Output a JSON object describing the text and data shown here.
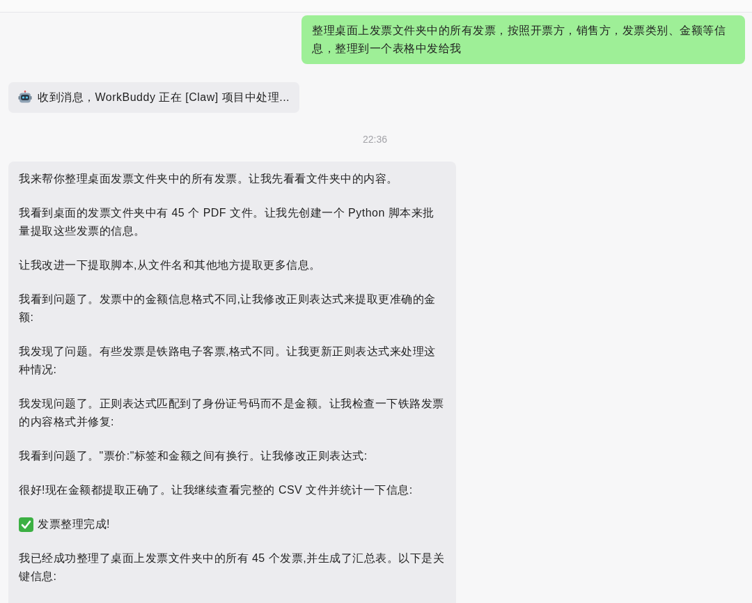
{
  "messages": [
    {
      "kind": "user",
      "text": "整理桌面上发票文件夹中的所有发票，按照开票方，销售方，发票类别、金额等信息，整理到一个表格中发给我"
    },
    {
      "kind": "status",
      "text": "收到消息，WorkBuddy 正在 [Claw] 项目中处理..."
    },
    {
      "kind": "time",
      "text": "22:36"
    },
    {
      "kind": "reply",
      "paragraphs": [
        {
          "kind": "text",
          "text": "我来帮你整理桌面发票文件夹中的所有发票。让我先看看文件夹中的内容。"
        },
        {
          "kind": "text",
          "text": "我看到桌面的发票文件夹中有 45 个 PDF 文件。让我先创建一个 Python 脚本来批量提取这些发票的信息。"
        },
        {
          "kind": "text",
          "text": "让我改进一下提取脚本,从文件名和其他地方提取更多信息。"
        },
        {
          "kind": "text",
          "text": "我看到问题了。发票中的金额信息格式不同,让我修改正则表达式来提取更准确的金额:"
        },
        {
          "kind": "text",
          "text": "我发现了问题。有些发票是铁路电子客票,格式不同。让我更新正则表达式来处理这种情况:"
        },
        {
          "kind": "text",
          "text": "我发现问题了。正则表达式匹配到了身份证号码而不是金额。让我检查一下铁路发票的内容格式并修复:"
        },
        {
          "kind": "text",
          "text": "我看到问题了。\"票价:\"标签和金额之间有换行。让我修改正则表达式:"
        },
        {
          "kind": "text",
          "text": "很好!现在金额都提取正确了。让我继续查看完整的 CSV 文件并统计一下信息:"
        },
        {
          "kind": "check",
          "text": "发票整理完成!"
        },
        {
          "kind": "text",
          "text": "我已经成功整理了桌面上发票文件夹中的所有 45 个发票,并生成了汇总表。以下是关键信息:"
        }
      ]
    }
  ]
}
